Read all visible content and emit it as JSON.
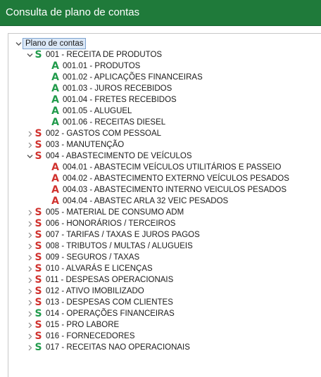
{
  "window": {
    "title": "Consulta de plano de contas"
  },
  "colors": {
    "S_green": "#1f9a4a",
    "S_red": "#d0312d",
    "A_green": "#1f9a4a",
    "A_red": "#d0312d",
    "titlebar": "#1f7a3a"
  },
  "tree": {
    "root_label": "Plano de contas",
    "nodes": [
      {
        "level": 1,
        "state": "expanded",
        "badge": "S",
        "badge_color": "green",
        "label": "001 - RECEITA DE PRODUTOS"
      },
      {
        "level": 2,
        "state": "leaf",
        "badge": "A",
        "badge_color": "green",
        "label": "001.01 - PRODUTOS"
      },
      {
        "level": 2,
        "state": "leaf",
        "badge": "A",
        "badge_color": "green",
        "label": "001.02 - APLICAÇÕES FINANCEIRAS"
      },
      {
        "level": 2,
        "state": "leaf",
        "badge": "A",
        "badge_color": "green",
        "label": "001.03 - JUROS RECEBIDOS"
      },
      {
        "level": 2,
        "state": "leaf",
        "badge": "A",
        "badge_color": "green",
        "label": "001.04 - FRETES RECEBIDOS"
      },
      {
        "level": 2,
        "state": "leaf",
        "badge": "A",
        "badge_color": "green",
        "label": "001.05 - ALUGUEL"
      },
      {
        "level": 2,
        "state": "leaf",
        "badge": "A",
        "badge_color": "green",
        "label": "001.06 - RECEITAS DIESEL"
      },
      {
        "level": 1,
        "state": "collapsed",
        "badge": "S",
        "badge_color": "red",
        "label": "002 - GASTOS COM PESSOAL"
      },
      {
        "level": 1,
        "state": "collapsed",
        "badge": "S",
        "badge_color": "red",
        "label": "003 - MANUTENÇÃO"
      },
      {
        "level": 1,
        "state": "expanded",
        "badge": "S",
        "badge_color": "red",
        "label": "004 - ABASTECIMENTO DE VEÍCULOS"
      },
      {
        "level": 2,
        "state": "leaf",
        "badge": "A",
        "badge_color": "red",
        "label": "004.01 - ABASTECIM VEÍCULOS UTILITÁRIOS E PASSEIO"
      },
      {
        "level": 2,
        "state": "leaf",
        "badge": "A",
        "badge_color": "red",
        "label": "004.02 - ABASTECIMENTO EXTERNO VEÍCULOS PESADOS"
      },
      {
        "level": 2,
        "state": "leaf",
        "badge": "A",
        "badge_color": "red",
        "label": "004.03 - ABASTECIMENTO INTERNO VEICULOS PESADOS"
      },
      {
        "level": 2,
        "state": "leaf",
        "badge": "A",
        "badge_color": "red",
        "label": "004.04 - ABASTEC ARLA 32 VEIC PESADOS"
      },
      {
        "level": 1,
        "state": "collapsed",
        "badge": "S",
        "badge_color": "red",
        "label": "005 - MATERIAL DE CONSUMO ADM"
      },
      {
        "level": 1,
        "state": "collapsed",
        "badge": "S",
        "badge_color": "red",
        "label": "006 - HONORÁRIOS / TERCEIROS"
      },
      {
        "level": 1,
        "state": "collapsed",
        "badge": "S",
        "badge_color": "red",
        "label": "007 - TARIFAS / TAXAS E JUROS PAGOS"
      },
      {
        "level": 1,
        "state": "collapsed",
        "badge": "S",
        "badge_color": "red",
        "label": "008 - TRIBUTOS / MULTAS / ALUGUEIS"
      },
      {
        "level": 1,
        "state": "collapsed",
        "badge": "S",
        "badge_color": "red",
        "label": "009 - SEGUROS / TAXAS"
      },
      {
        "level": 1,
        "state": "collapsed",
        "badge": "S",
        "badge_color": "red",
        "label": "010 - ALVARÁS E LICENÇAS"
      },
      {
        "level": 1,
        "state": "collapsed",
        "badge": "S",
        "badge_color": "red",
        "label": "011 - DESPESAS OPERACIONAIS"
      },
      {
        "level": 1,
        "state": "collapsed",
        "badge": "S",
        "badge_color": "red",
        "label": "012 - ATIVO IMOBILIZADO"
      },
      {
        "level": 1,
        "state": "collapsed",
        "badge": "S",
        "badge_color": "red",
        "label": "013 - DESPESAS COM CLIENTES"
      },
      {
        "level": 1,
        "state": "collapsed",
        "badge": "S",
        "badge_color": "green",
        "label": "014 - OPERAÇÕES FINANCEIRAS"
      },
      {
        "level": 1,
        "state": "collapsed",
        "badge": "S",
        "badge_color": "red",
        "label": "015 - PRO LABORE"
      },
      {
        "level": 1,
        "state": "collapsed",
        "badge": "S",
        "badge_color": "red",
        "label": "016 - FORNECEDORES"
      },
      {
        "level": 1,
        "state": "collapsed",
        "badge": "S",
        "badge_color": "green",
        "label": "017 - RECEITAS NAO OPERACIONAIS"
      }
    ]
  }
}
